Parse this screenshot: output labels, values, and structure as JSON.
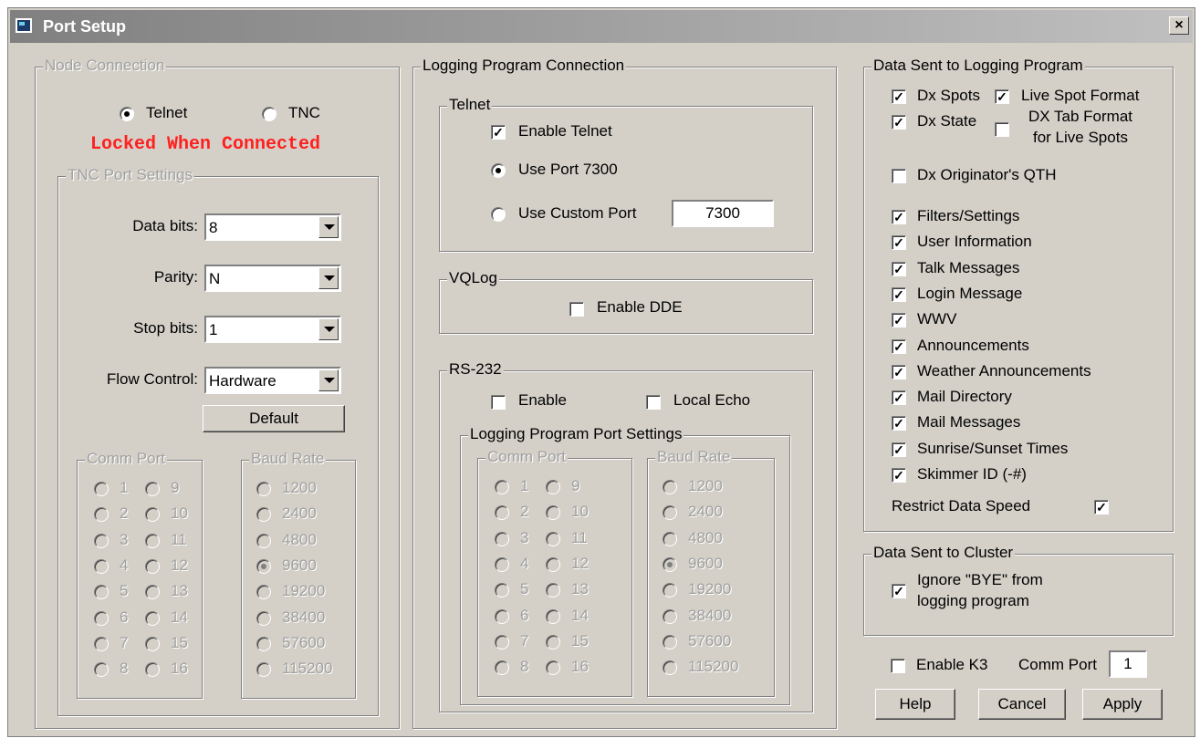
{
  "window": {
    "title": "Port Setup",
    "close": "×"
  },
  "node_connection": {
    "legend": "Node Connection",
    "telnet": "Telnet",
    "tnc": "TNC",
    "locked": "Locked When Connected",
    "tnc_settings": {
      "legend": "TNC Port Settings",
      "data_bits_label": "Data bits:",
      "data_bits": "8",
      "parity_label": "Parity:",
      "parity": "N",
      "stop_bits_label": "Stop bits:",
      "stop_bits": "1",
      "flow_label": "Flow Control:",
      "flow": "Hardware",
      "default_button": "Default"
    },
    "comm_port": {
      "legend": "Comm Port",
      "col1": [
        "1",
        "2",
        "3",
        "4",
        "5",
        "6",
        "7",
        "8"
      ],
      "col2": [
        "9",
        "10",
        "11",
        "12",
        "13",
        "14",
        "15",
        "16"
      ]
    },
    "baud_rate": {
      "legend": "Baud Rate",
      "options": [
        "1200",
        "2400",
        "4800",
        "9600",
        "19200",
        "38400",
        "57600",
        "115200"
      ],
      "selected": "9600"
    }
  },
  "logging_connection": {
    "legend": "Logging Program Connection",
    "telnet": {
      "legend": "Telnet",
      "enable": "Enable Telnet",
      "use_port": "Use Port 7300",
      "use_custom": "Use Custom Port",
      "custom_port": "7300"
    },
    "vqlog": {
      "legend": "VQLog",
      "enable_dde": "Enable DDE"
    },
    "rs232": {
      "legend": "RS-232",
      "enable": "Enable",
      "local_echo": "Local Echo",
      "settings_legend": "Logging Program Port Settings",
      "comm_port": {
        "legend": "Comm Port",
        "col1": [
          "1",
          "2",
          "3",
          "4",
          "5",
          "6",
          "7",
          "8"
        ],
        "col2": [
          "9",
          "10",
          "11",
          "12",
          "13",
          "14",
          "15",
          "16"
        ]
      },
      "baud_rate": {
        "legend": "Baud Rate",
        "options": [
          "1200",
          "2400",
          "4800",
          "9600",
          "19200",
          "38400",
          "57600",
          "115200"
        ],
        "selected": "9600"
      }
    }
  },
  "data_sent_logging": {
    "legend": "Data Sent to Logging Program",
    "dx_spots": "Dx Spots",
    "live_spot_format": "Live Spot Format",
    "dx_state": "Dx State",
    "dx_tab_format_1": "DX Tab Format",
    "dx_tab_format_2": "for Live Spots",
    "dx_originator": "Dx Originator's QTH",
    "items": [
      "Filters/Settings",
      "User Information",
      "Talk Messages",
      "Login Message",
      "WWV",
      "Announcements",
      "Weather Announcements",
      "Mail Directory",
      "Mail Messages",
      "Sunrise/Sunset Times",
      "Skimmer ID (-#)"
    ],
    "restrict_speed": "Restrict Data Speed"
  },
  "data_sent_cluster": {
    "legend": "Data Sent to Cluster",
    "ignore_bye_1": "Ignore \"BYE\" from",
    "ignore_bye_2": "logging program"
  },
  "k3": {
    "enable": "Enable K3",
    "comm_port_label": "Comm Port",
    "comm_port": "1"
  },
  "buttons": {
    "help": "Help",
    "cancel": "Cancel",
    "apply": "Apply"
  }
}
